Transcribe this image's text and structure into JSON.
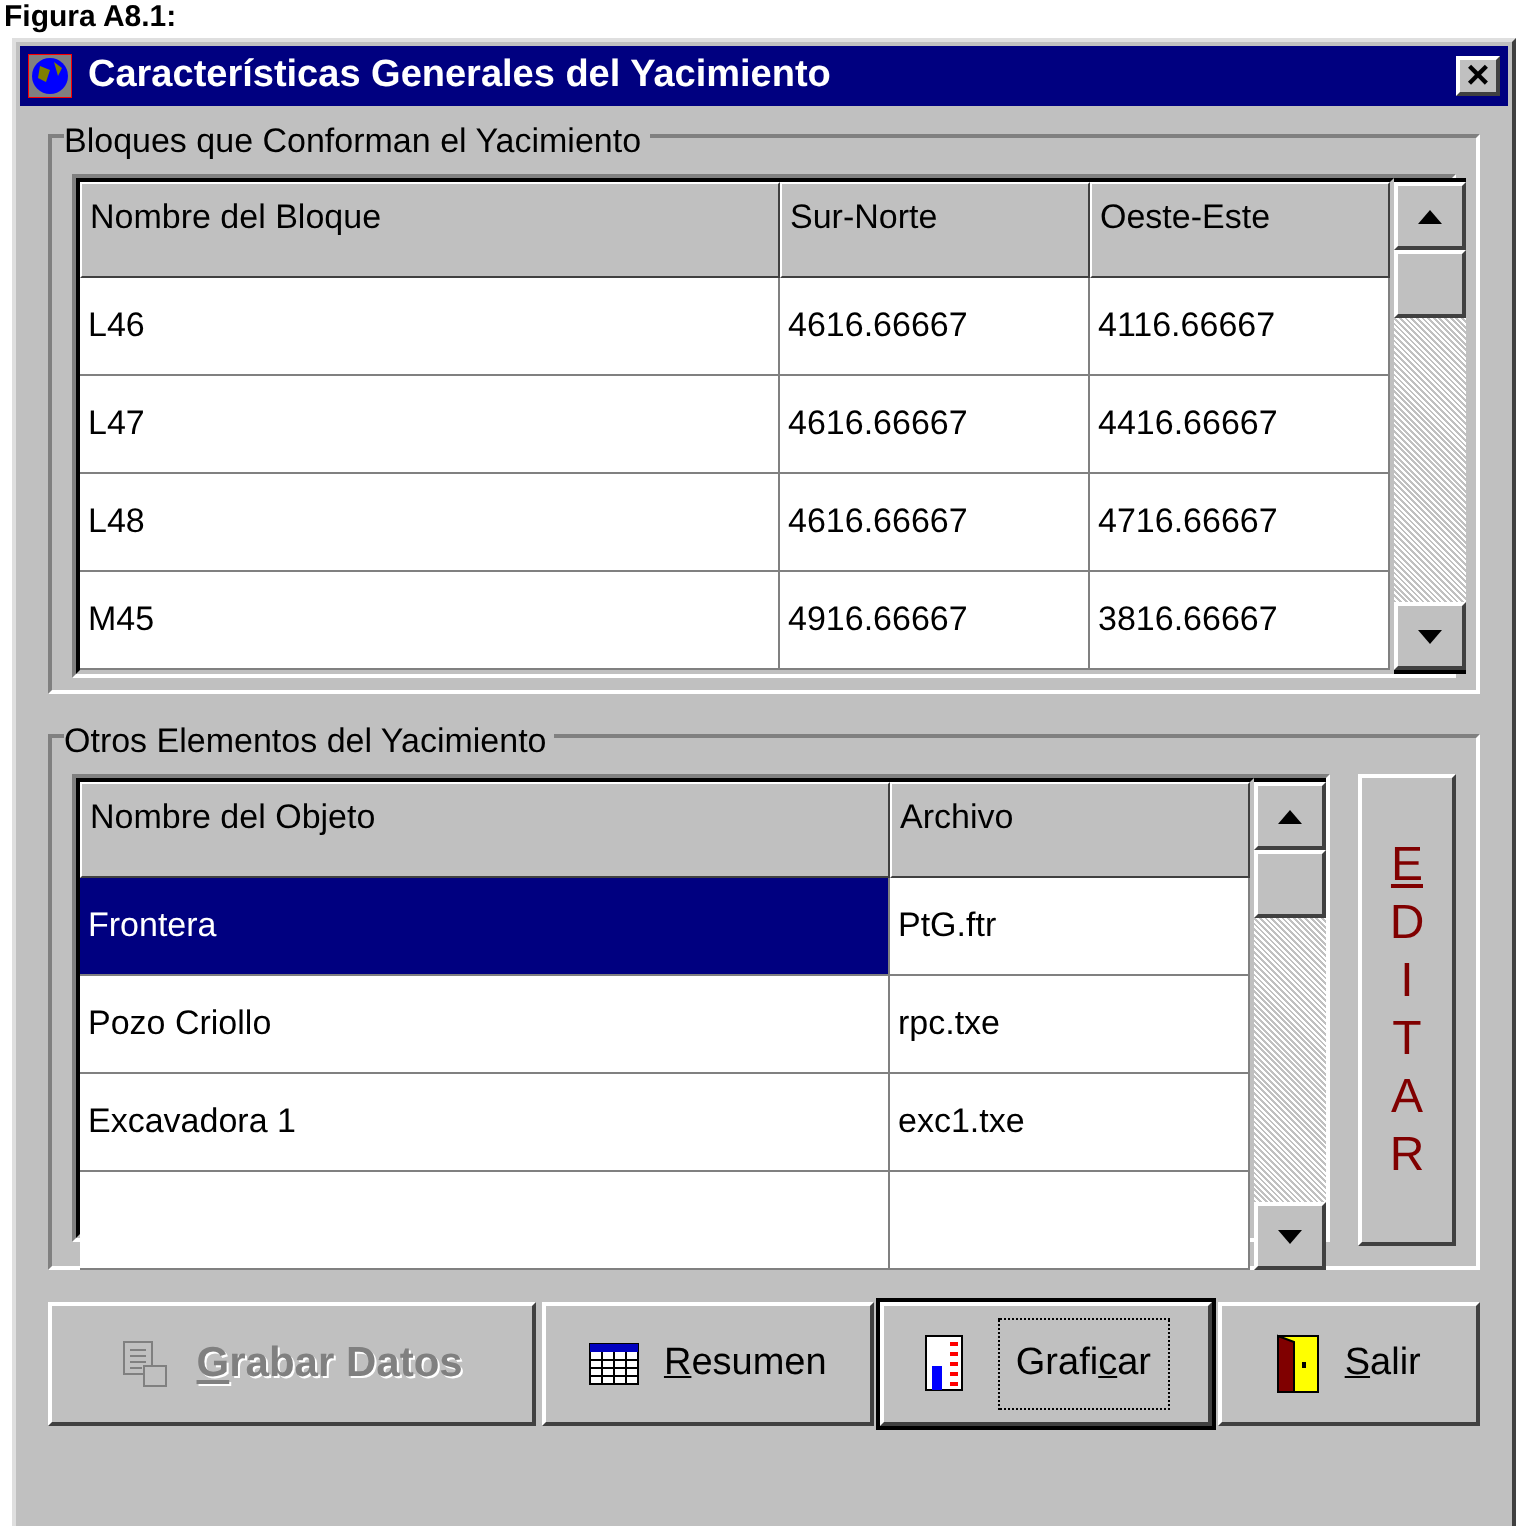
{
  "caption": "Figura A8.1:",
  "window": {
    "title": "Características Generales del Yacimiento",
    "close": "×"
  },
  "blocks_group": {
    "title": "Bloques que Conforman el Yacimiento",
    "columns": [
      "Nombre del Bloque",
      "Sur-Norte",
      "Oeste-Este"
    ],
    "rows": [
      {
        "cells": [
          "L46",
          "4616.66667",
          "4116.66667"
        ],
        "selected": false
      },
      {
        "cells": [
          "L47",
          "4616.66667",
          "4416.66667"
        ],
        "selected": false
      },
      {
        "cells": [
          "L48",
          "4616.66667",
          "4716.66667"
        ],
        "selected": false
      },
      {
        "cells": [
          "M45",
          "4916.66667",
          "3816.66667"
        ],
        "selected": false
      }
    ]
  },
  "objects_group": {
    "title": "Otros Elementos del Yacimiento",
    "columns": [
      "Nombre del Objeto",
      "Archivo"
    ],
    "rows": [
      {
        "cells": [
          "Frontera",
          "PtG.ftr"
        ],
        "selected": true
      },
      {
        "cells": [
          "Pozo Criollo",
          "rpc.txe"
        ],
        "selected": false
      },
      {
        "cells": [
          "Excavadora 1",
          "exc1.txe"
        ],
        "selected": false
      },
      {
        "cells": [
          "",
          ""
        ],
        "selected": false
      }
    ],
    "edit_button": {
      "letters": [
        {
          "text": "E",
          "underlined": true
        },
        {
          "text": "D",
          "underlined": false
        },
        {
          "text": "I",
          "underlined": false
        },
        {
          "text": "T",
          "underlined": false
        },
        {
          "text": "A",
          "underlined": false
        },
        {
          "text": "R",
          "underlined": false
        }
      ]
    }
  },
  "buttons": [
    {
      "label_parts": [
        {
          "text": "G",
          "underlined": true
        },
        {
          "text": "rabar Datos",
          "underlined": false
        }
      ],
      "kind": "save",
      "disabled": true,
      "focused": false
    },
    {
      "label_parts": [
        {
          "text": "R",
          "underlined": true
        },
        {
          "text": "esumen",
          "underlined": false
        }
      ],
      "kind": "table",
      "disabled": false,
      "focused": false
    },
    {
      "label_parts": [
        {
          "text": "Grafi",
          "underlined": false
        },
        {
          "text": "c",
          "underlined": true
        },
        {
          "text": "ar",
          "underlined": false
        }
      ],
      "kind": "chart",
      "disabled": false,
      "focused": true
    },
    {
      "label_parts": [
        {
          "text": "S",
          "underlined": true
        },
        {
          "text": "alir",
          "underlined": false
        }
      ],
      "kind": "door",
      "disabled": false,
      "focused": false
    }
  ]
}
